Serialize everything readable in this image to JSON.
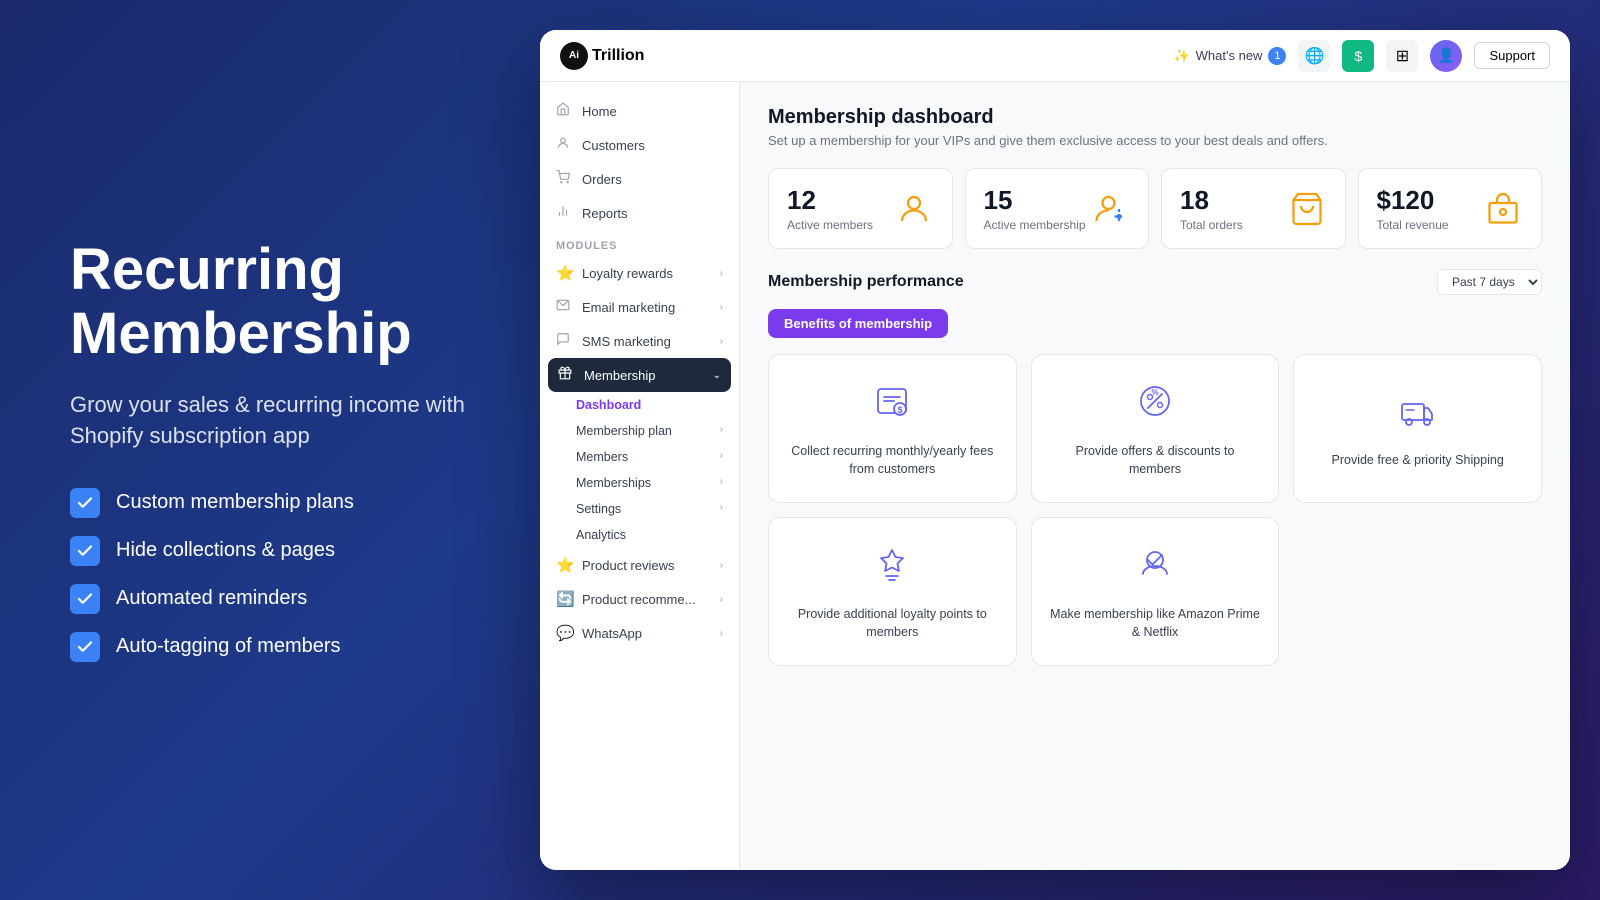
{
  "left": {
    "title_line1": "Recurring",
    "title_line2": "Membership",
    "subtitle": "Grow your sales & recurring income with Shopify subscription app",
    "features": [
      {
        "id": "f1",
        "text": "Custom membership plans"
      },
      {
        "id": "f2",
        "text": "Hide collections & pages"
      },
      {
        "id": "f3",
        "text": "Automated reminders"
      },
      {
        "id": "f4",
        "text": "Auto-tagging of members"
      }
    ]
  },
  "topbar": {
    "logo_text": "Trillion",
    "logo_prefix": "Ai",
    "whats_new": "What's new",
    "badge": "1",
    "support_btn": "Support"
  },
  "nav": {
    "top_items": [
      {
        "id": "home",
        "label": "Home",
        "icon": "🏠"
      },
      {
        "id": "customers",
        "label": "Customers",
        "icon": "👤"
      },
      {
        "id": "orders",
        "label": "Orders",
        "icon": "🛒"
      },
      {
        "id": "reports",
        "label": "Reports",
        "icon": "📊"
      }
    ],
    "modules_label": "MODULES",
    "module_items": [
      {
        "id": "loyalty",
        "label": "Loyalty rewards",
        "icon": "⭐",
        "has_chevron": true
      },
      {
        "id": "email",
        "label": "Email marketing",
        "icon": "✉️",
        "has_chevron": true
      },
      {
        "id": "sms",
        "label": "SMS marketing",
        "icon": "💬",
        "has_chevron": true
      },
      {
        "id": "membership",
        "label": "Membership",
        "icon": "🔷",
        "active": true,
        "has_chevron": true
      }
    ],
    "membership_sub": [
      {
        "id": "dashboard",
        "label": "Dashboard",
        "active": true
      },
      {
        "id": "plan",
        "label": "Membership plan",
        "has_chevron": true
      },
      {
        "id": "members",
        "label": "Members",
        "has_chevron": true
      },
      {
        "id": "memberships",
        "label": "Memberships",
        "has_chevron": true
      },
      {
        "id": "settings",
        "label": "Settings",
        "has_chevron": true
      },
      {
        "id": "analytics",
        "label": "Analytics"
      }
    ],
    "bottom_items": [
      {
        "id": "product-reviews",
        "label": "Product reviews",
        "icon": "⭐",
        "has_chevron": true
      },
      {
        "id": "product-rec",
        "label": "Product recomme...",
        "icon": "🔄",
        "has_chevron": true
      },
      {
        "id": "whatsapp",
        "label": "WhatsApp",
        "icon": "💬",
        "has_chevron": true
      }
    ]
  },
  "dashboard": {
    "title": "Membership dashboard",
    "subtitle": "Set up a membership for your VIPs and give them exclusive access to your best deals and offers.",
    "stats": [
      {
        "id": "active-members",
        "number": "12",
        "label": "Active members"
      },
      {
        "id": "active-membership",
        "number": "15",
        "label": "Active membership"
      },
      {
        "id": "total-orders",
        "number": "18",
        "label": "Total orders"
      },
      {
        "id": "total-revenue",
        "number": "$120",
        "label": "Total revenue"
      }
    ],
    "performance_title": "Membership performance",
    "period": "Past 7 days",
    "tabs": [
      {
        "id": "benefits",
        "label": "Benefits of membership",
        "active": true
      }
    ],
    "benefit_cards": [
      {
        "id": "collect-fees",
        "text": "Collect recurring monthly/yearly fees from customers"
      },
      {
        "id": "offers-discounts",
        "text": "Provide offers & discounts to members"
      },
      {
        "id": "free-shipping",
        "text": "Provide free & priority Shipping"
      },
      {
        "id": "loyalty-points",
        "text": "Provide additional loyalty points to members"
      },
      {
        "id": "like-prime",
        "text": "Make membership like Amazon Prime & Netflix"
      }
    ]
  }
}
